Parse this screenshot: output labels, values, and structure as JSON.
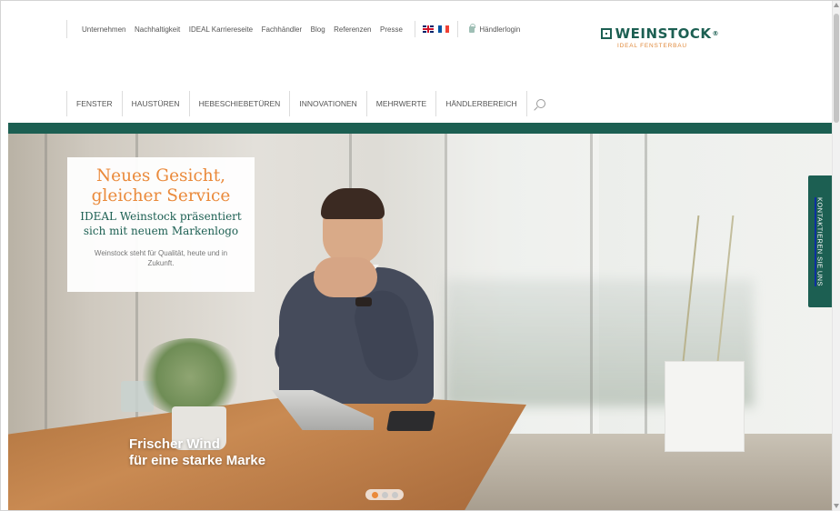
{
  "topnav": {
    "links": [
      "Unternehmen",
      "Nachhaltigkeit",
      "IDEAL Karriereseite",
      "Fachhändler",
      "Blog",
      "Referenzen",
      "Presse"
    ],
    "languages": [
      "uk-flag-icon",
      "fr-flag-icon"
    ],
    "dealer_login": "Händlerlogin"
  },
  "logo": {
    "name": "WEINSTOCK",
    "registered": "®",
    "subtitle": "IDEAL FENSTERBAU"
  },
  "mainnav": {
    "items": [
      "FENSTER",
      "HAUSTÜREN",
      "HEBESCHIEBETÜREN",
      "INNOVATIONEN",
      "MEHRWERTE",
      "HÄNDLERBEREICH"
    ],
    "search_icon": "search-icon"
  },
  "hero": {
    "promo": {
      "headline_line1": "Neues Gesicht,",
      "headline_line2": "gleicher Service",
      "subheadline_line1": "IDEAL Weinstock präsentiert",
      "subheadline_line2": "sich mit neuem Markenlogo",
      "body": "Weinstock steht für Qualität, heute und in Zukunft."
    },
    "caption_line1": "Frischer Wind",
    "caption_line2": "für eine starke Marke",
    "slider": {
      "active_index": 1,
      "count": 3
    }
  },
  "contact_tab": "KONTAKTIEREN SIE UNS",
  "colors": {
    "brand_teal": "#1c5f52",
    "accent_orange": "#ea8a3b"
  }
}
